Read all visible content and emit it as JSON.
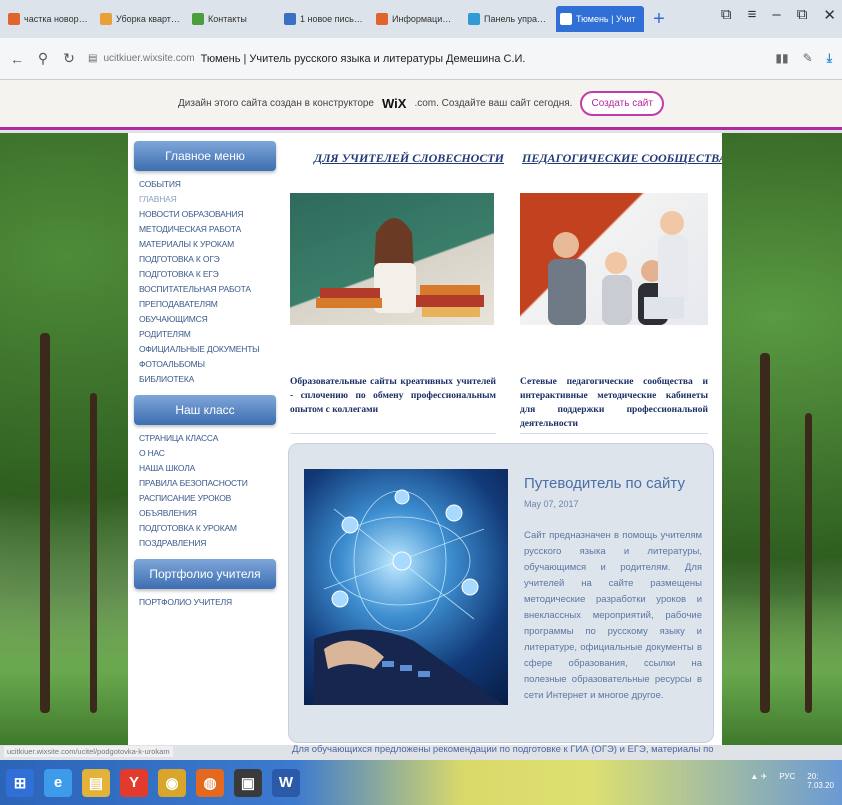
{
  "browser": {
    "tabs": [
      {
        "label": "частка новоро –",
        "color": "#e0642b",
        "active": false
      },
      {
        "label": "Уборка квартир",
        "color": "#e8a13a",
        "active": false
      },
      {
        "label": "Контакты",
        "color": "#4c9d3c",
        "active": false
      },
      {
        "label": "1 новое письмо",
        "color": "#3a6fc4",
        "active": false
      },
      {
        "label": "Информационно",
        "color": "#e0642b",
        "active": false
      },
      {
        "label": "Панель управле",
        "color": "#2f9ad6",
        "active": false
      },
      {
        "label": "Тюмень | Учит",
        "color": "#ffffff",
        "active": true
      }
    ],
    "new_tab": "+",
    "window_controls": [
      "⧉",
      "≡",
      "–",
      "⧉",
      "✕"
    ],
    "address": {
      "domain": "ucitkiuer.wixsite.com",
      "page_title": "Тюмень | Учитель русского языка и литературы Демешина С.И."
    }
  },
  "wix_banner": {
    "text_before": "Дизайн этого сайта создан в конструкторе",
    "logo": "WiX",
    "text_after": ".com. Создайте ваш сайт сегодня.",
    "button": "Создать сайт"
  },
  "site": {
    "main_menu": {
      "heading": "Главное меню",
      "items": [
        "События",
        "Главная",
        "Новости образования",
        "Методическая работа",
        "Материалы к урокам",
        "Подготовка к ОГЭ",
        "Подготовка к ЕГЭ",
        "Воспитательная работа",
        "Преподавателям",
        "Обучающимся",
        "Родителям",
        "Официальные документы",
        "Фотоальбомы",
        "Библиотека"
      ],
      "current_index": 1
    },
    "class_menu": {
      "heading": "Наш класс",
      "items": [
        "Страница класса",
        "О нас",
        "Наша школа",
        "Правила безопасности",
        "Расписание уроков",
        "Объявления",
        "Подготовка к урокам",
        "Поздравления"
      ]
    },
    "portfolio_menu": {
      "heading": "Портфолио учителя",
      "items": [
        "Портфолио учителя"
      ]
    },
    "section_left": {
      "heading": "Для учителей словесности",
      "caption": "Образовательные сайты креативных учителей - сплочению по обмену профессиональным опытом с коллегами"
    },
    "section_right": {
      "heading": "Педагогические сообщества",
      "caption": "Сетевые педагогические сообщества и интерактивные методические кабинеты для поддержки профессиональной деятельности"
    },
    "guide": {
      "title": "Путеводитель по сайту",
      "date": "May 07, 2017",
      "body": "Сайт предназначен в помощь учителям русского языка и литературы, обучающимся и родителям. Для учителей на сайте размещены методические разработки уроков и внеклассных мероприятий, рабочие программы по русскому языку и литературе, официальные документы в сфере образования, ссылки на полезные образовательные ресурсы в сети Интернет и многое другое.",
      "footer": "Для обучающихся предложены рекомендации по подготовке к ГИА (ОГЭ) и ЕГЭ, материалы по"
    }
  },
  "status_url": "ucitkiuer.wixsite.com/ucitel/podgotovka-k-urokam",
  "taskbar": {
    "icons": [
      {
        "name": "windows-start-icon",
        "glyph": "⊞",
        "color": "#2f6fd6"
      },
      {
        "name": "ie-icon",
        "glyph": "e",
        "color": "#3d9be9"
      },
      {
        "name": "explorer-icon",
        "glyph": "▤",
        "color": "#e2b23a"
      },
      {
        "name": "yandex-browser-icon",
        "glyph": "Y",
        "color": "#e33a2e"
      },
      {
        "name": "chrome-icon",
        "glyph": "◉",
        "color": "#d9a62c"
      },
      {
        "name": "firefox-icon",
        "glyph": "◍",
        "color": "#e4691f"
      },
      {
        "name": "tv-app-icon",
        "glyph": "▣",
        "color": "#3a3a3a"
      },
      {
        "name": "word-icon",
        "glyph": "W",
        "color": "#2b5aa8"
      }
    ],
    "tray_lang": "РУС",
    "tray_time": "20:",
    "tray_date": "7.03.20"
  }
}
